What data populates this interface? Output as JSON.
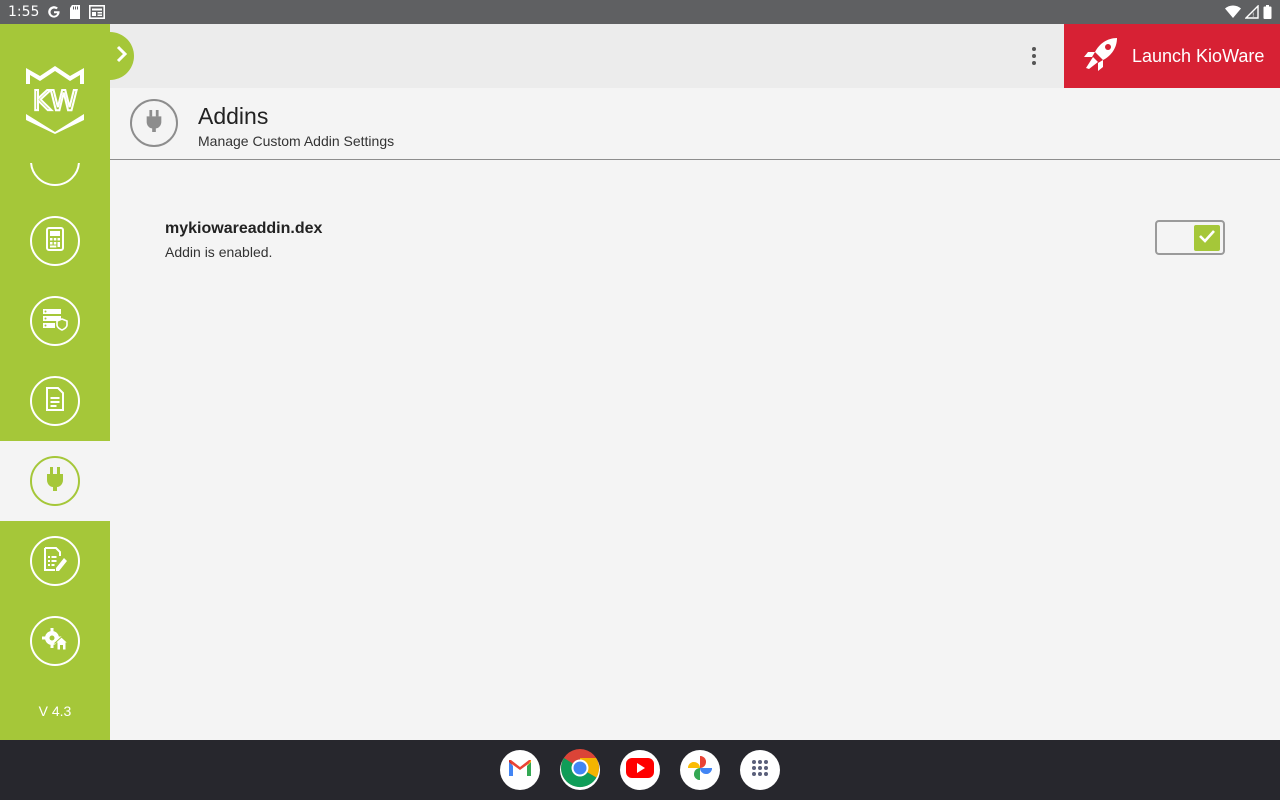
{
  "status_bar": {
    "time": "1:55",
    "icons": [
      "google-icon",
      "sd-card-icon",
      "news-icon",
      "wifi-icon",
      "signal-icon",
      "battery-icon"
    ]
  },
  "sidebar": {
    "logo_text": "KW",
    "items": [
      {
        "name": "nav-item-partial",
        "icon": "unknown-icon",
        "active": false
      },
      {
        "name": "nav-item-device",
        "icon": "device-icon",
        "active": false
      },
      {
        "name": "nav-item-server",
        "icon": "server-shield-icon",
        "active": false
      },
      {
        "name": "nav-item-document",
        "icon": "document-icon",
        "active": false
      },
      {
        "name": "nav-item-addins",
        "icon": "plug-icon",
        "active": true
      },
      {
        "name": "nav-item-edit-log",
        "icon": "edit-document-icon",
        "active": false
      },
      {
        "name": "nav-item-settings-home",
        "icon": "settings-home-icon",
        "active": false
      }
    ],
    "version": "V 4.3"
  },
  "header": {
    "launch_label": "Launch KioWare",
    "launch_color": "#d72134"
  },
  "page": {
    "title": "Addins",
    "subtitle": "Manage Custom Addin Settings"
  },
  "addins": [
    {
      "name": "mykiowareaddin.dex",
      "status": "Addin is enabled.",
      "enabled": true
    }
  ],
  "taskbar": {
    "apps": [
      "gmail-icon",
      "chrome-icon",
      "youtube-icon",
      "photos-icon",
      "app-drawer-icon"
    ]
  },
  "colors": {
    "accent": "#a5c739",
    "launch": "#d72134"
  }
}
